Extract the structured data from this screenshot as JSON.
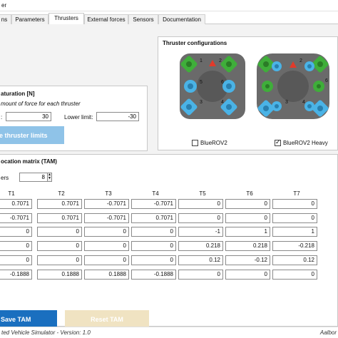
{
  "window": {
    "title": "er"
  },
  "tabs": [
    {
      "label": "ns"
    },
    {
      "label": "Parameters"
    },
    {
      "label": "Thrusters"
    },
    {
      "label": "External forces"
    },
    {
      "label": "Sensors"
    },
    {
      "label": "Documentation"
    }
  ],
  "active_tab": "Thrusters",
  "saturation": {
    "title": "aturation [N]",
    "description": "mount of force for each thruster",
    "upper_value": "30",
    "lower_label": "Lower limit:",
    "lower_value": "-30",
    "button_label": "e thruster limits"
  },
  "configurations": {
    "title": "Thruster configurations",
    "options": [
      {
        "label": "BlueROV2",
        "checked": false
      },
      {
        "label": "BlueROV2 Heavy",
        "checked": true
      }
    ],
    "colors": {
      "body": "#6a6a6a",
      "green_thruster": "#3fae3a",
      "blue_thruster": "#4ab3e6",
      "marker": "#e23a2a"
    }
  },
  "tam": {
    "title": "ocation matrix (TAM)",
    "count_label": "ers",
    "count_value": "8",
    "columns": [
      "T1",
      "T2",
      "T3",
      "T4",
      "T5",
      "T6",
      "T7"
    ],
    "rows": [
      [
        "0.7071",
        "0.7071",
        "-0.7071",
        "-0.7071",
        "0",
        "0",
        "0"
      ],
      [
        "-0.7071",
        "0.7071",
        "-0.7071",
        "0.7071",
        "0",
        "0",
        "0"
      ],
      [
        "0",
        "0",
        "0",
        "0",
        "-1",
        "1",
        "1"
      ],
      [
        "0",
        "0",
        "0",
        "0",
        "0.218",
        "0.218",
        "-0.218"
      ],
      [
        "0",
        "0",
        "0",
        "0",
        "0.12",
        "-0.12",
        "0.12"
      ],
      [
        "-0.1888",
        "0.1888",
        "0.1888",
        "-0.1888",
        "0",
        "0",
        "0"
      ]
    ],
    "save_label": "Save TAM",
    "reset_label": "Reset TAM"
  },
  "status": {
    "left": "ted Vehicle Simulator - Version: 1.0",
    "right": "Aalbor"
  }
}
